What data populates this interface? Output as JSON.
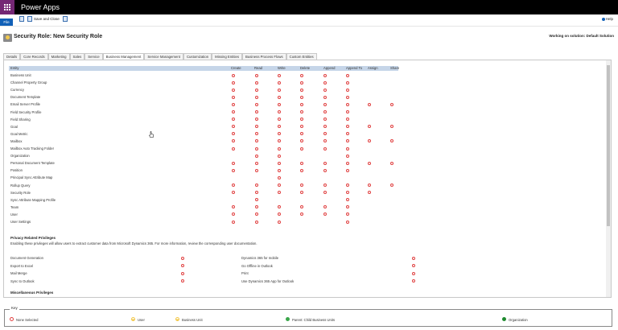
{
  "app": {
    "title": "Power Apps"
  },
  "commandbar": {
    "file_label": "File",
    "save_close_label": "Save and Close",
    "help_label": "Help"
  },
  "header": {
    "title": "Security Role: New Security Role",
    "solution_text": "Working on solution: Default Solution"
  },
  "tabs": [
    "Details",
    "Core Records",
    "Marketing",
    "Sales",
    "Service",
    "Business Management",
    "Service Management",
    "Customization",
    "Missing Entities",
    "Business Process Flows",
    "Custom Entities"
  ],
  "active_tab": "Business Management",
  "grid": {
    "columns": [
      "Entity",
      "Create",
      "Read",
      "Write",
      "Delete",
      "Append",
      "Append To",
      "Assign",
      "Share"
    ],
    "rows": [
      {
        "name": "Business Unit",
        "p": [
          1,
          1,
          1,
          1,
          1,
          1,
          0,
          0
        ]
      },
      {
        "name": "Channel Property Group",
        "p": [
          1,
          1,
          1,
          1,
          1,
          1,
          0,
          0
        ]
      },
      {
        "name": "Currency",
        "p": [
          1,
          1,
          1,
          1,
          1,
          1,
          0,
          0
        ]
      },
      {
        "name": "Document Template",
        "p": [
          1,
          1,
          1,
          1,
          1,
          1,
          0,
          0
        ]
      },
      {
        "name": "Email Server Profile",
        "p": [
          1,
          1,
          1,
          1,
          1,
          1,
          1,
          1
        ]
      },
      {
        "name": "Field Security Profile",
        "p": [
          1,
          1,
          1,
          1,
          1,
          1,
          0,
          0
        ]
      },
      {
        "name": "Field Sharing",
        "p": [
          1,
          1,
          1,
          1,
          1,
          1,
          0,
          0
        ]
      },
      {
        "name": "Goal",
        "p": [
          1,
          1,
          1,
          1,
          1,
          1,
          1,
          1
        ]
      },
      {
        "name": "Goal Metric",
        "p": [
          1,
          1,
          1,
          1,
          1,
          1,
          0,
          0
        ]
      },
      {
        "name": "Mailbox",
        "p": [
          1,
          1,
          1,
          1,
          1,
          1,
          1,
          1
        ]
      },
      {
        "name": "Mailbox Auto Tracking Folder",
        "p": [
          1,
          1,
          1,
          1,
          1,
          1,
          0,
          0
        ]
      },
      {
        "name": "Organization",
        "p": [
          0,
          1,
          1,
          0,
          0,
          1,
          0,
          0
        ]
      },
      {
        "name": "Personal Document Template",
        "p": [
          1,
          1,
          1,
          1,
          1,
          1,
          1,
          1
        ]
      },
      {
        "name": "Position",
        "p": [
          1,
          1,
          1,
          1,
          1,
          1,
          0,
          0
        ]
      },
      {
        "name": "Principal Sync Attribute Map",
        "p": [
          0,
          0,
          1,
          0,
          0,
          0,
          0,
          0
        ]
      },
      {
        "name": "Rollup Query",
        "p": [
          1,
          1,
          1,
          1,
          1,
          1,
          1,
          1
        ]
      },
      {
        "name": "Security Role",
        "p": [
          1,
          1,
          1,
          1,
          1,
          1,
          1,
          0
        ]
      },
      {
        "name": "Sync Attribute Mapping Profile",
        "p": [
          0,
          1,
          0,
          0,
          0,
          1,
          0,
          0
        ]
      },
      {
        "name": "Team",
        "p": [
          1,
          1,
          1,
          1,
          1,
          1,
          0,
          0
        ]
      },
      {
        "name": "User",
        "p": [
          1,
          1,
          1,
          1,
          1,
          1,
          0,
          0
        ]
      },
      {
        "name": "User Settings",
        "p": [
          1,
          1,
          1,
          0,
          0,
          1,
          0,
          0
        ]
      }
    ]
  },
  "privacy": {
    "title": "Privacy Related Privileges",
    "note": "Enabling these privileges will allow users to extract customer data from Microsoft Dynamics 365. For more information, review the corresponding user documentation.",
    "left": [
      "Document Generation",
      "Export to Excel",
      "Mail Merge",
      "Sync to Outlook"
    ],
    "right": [
      "Dynamics 365 for mobile",
      "Go Offline in Outlook",
      "Print",
      "Use Dynamics 365 App for Outlook"
    ]
  },
  "misc": {
    "title": "Miscellaneous Privileges"
  },
  "key": {
    "title": "Key",
    "items": [
      {
        "label": "None Selected",
        "color": "#e04040"
      },
      {
        "label": "User",
        "color": "#f2c84b"
      },
      {
        "label": "Business Unit",
        "color": "#f2c84b"
      },
      {
        "label": "Parent: Child Business Units",
        "color": "#3aa64a"
      },
      {
        "label": "Organization",
        "color": "#1e8a2e"
      }
    ]
  }
}
